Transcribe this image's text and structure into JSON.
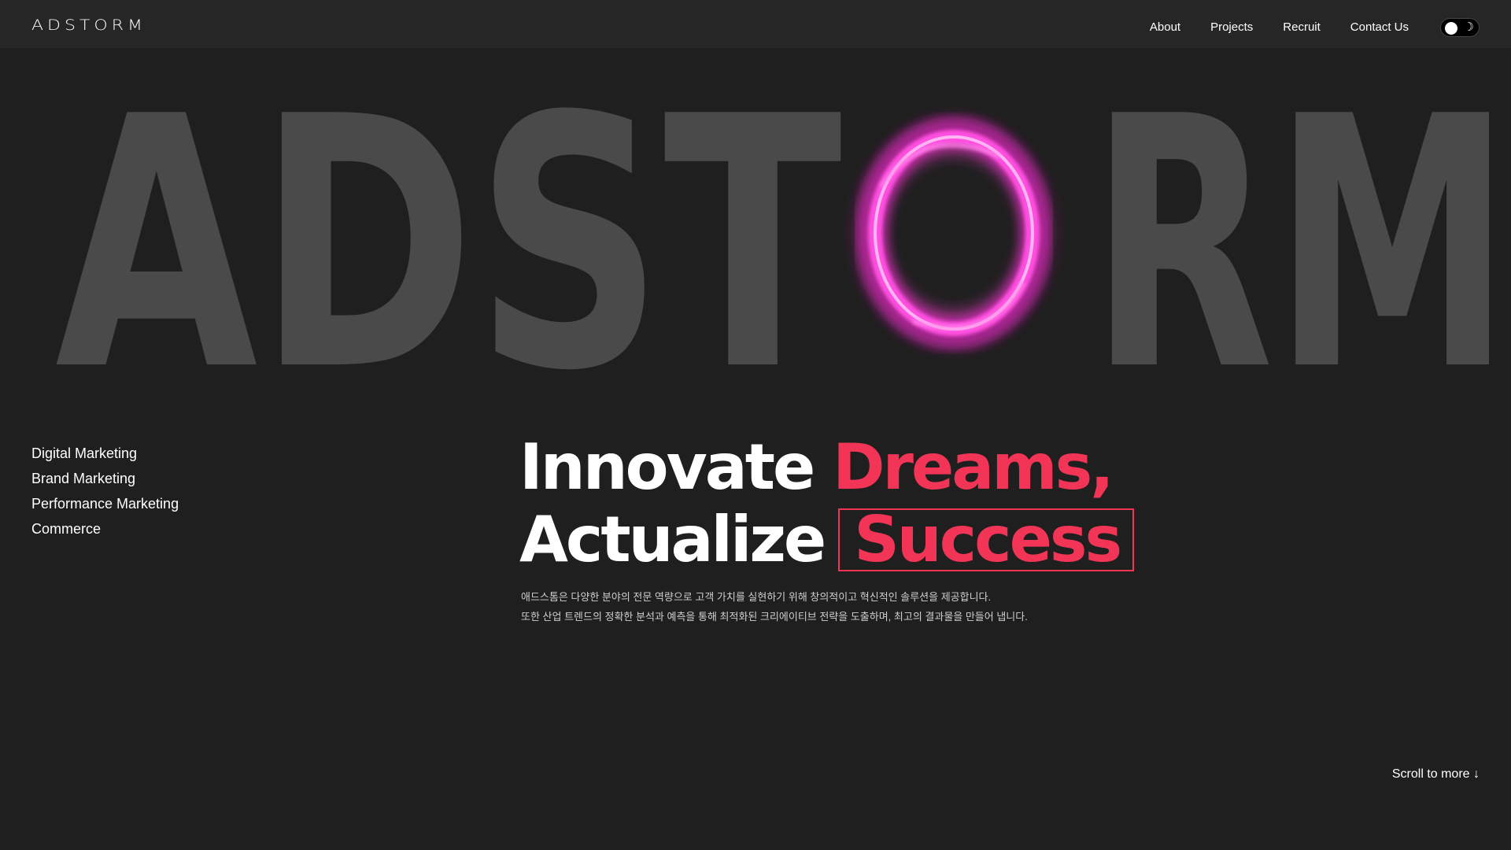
{
  "header": {
    "logo": "ADSTORM",
    "nav": [
      "About",
      "Projects",
      "Recruit",
      "Contact Us"
    ],
    "theme_toggle_icon": "moon-icon"
  },
  "hero": {
    "big_word": "ADSTORM",
    "ring_color": "#ff40d6"
  },
  "services": [
    "Digital Marketing",
    "Brand Marketing",
    "Performance Marketing",
    "Commerce"
  ],
  "headline": {
    "line1_white": "Innovate",
    "line1_accent": "Dreams,",
    "line2_white": "Actualize",
    "line2_boxed": "Success"
  },
  "description": [
    "애드스톰은 다양한 분야의 전문 역량으로 고객 가치를 실현하기 위해 창의적이고 혁신적인 솔루션을 제공합니다.",
    "또한 산업 트렌드의 정확한 분석과 예측을 통해 최적화된 크리에이티브 전략을 도출하며, 최고의 결과물을 만들어 냅니다."
  ],
  "scroll_more": "Scroll to more ↓",
  "colors": {
    "accent": "#f23557",
    "background": "#1f1f1f",
    "header_bg": "#262626",
    "big_word": "#4a4a4a"
  }
}
